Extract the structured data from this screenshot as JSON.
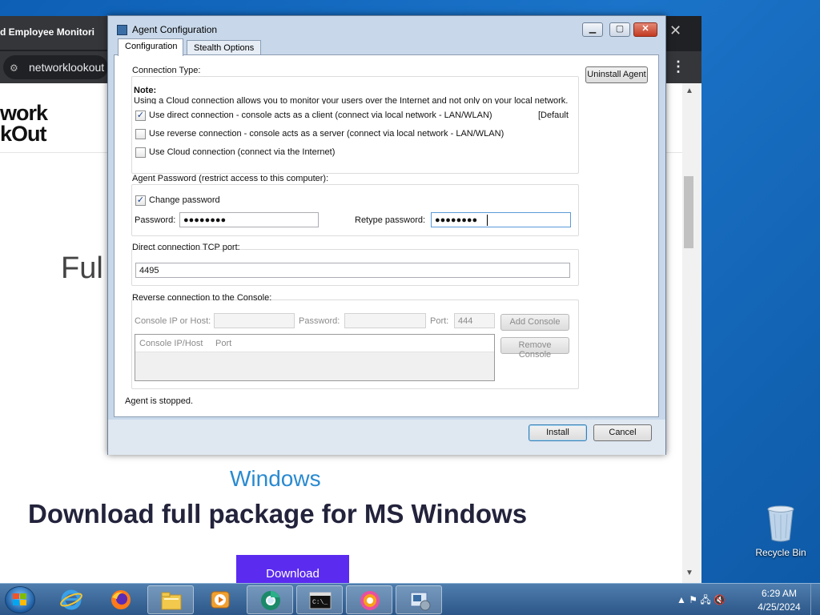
{
  "browser": {
    "tab_title": "d Employee Monitori",
    "address": "networklookout",
    "logo_line1": "work",
    "logo_line2": "kOut",
    "page_heading_partial": "Ful",
    "page_subheading": "Windows",
    "download_heading": "Download full package for MS Windows",
    "download_button": "Download"
  },
  "dialog": {
    "title": "Agent Configuration",
    "tabs": [
      {
        "label": "Configuration",
        "active": true
      },
      {
        "label": "Stealth Options",
        "active": false
      }
    ],
    "uninstall_button": "Uninstall Agent",
    "connection_type": {
      "title": "Connection Type:",
      "note_label": "Note:",
      "note_text": "Using a Cloud connection allows you to monitor your users over the Internet and not only on your local network.",
      "options": [
        {
          "label": "Use direct connection - console acts as a client (connect via local network - LAN/WLAN)",
          "checked": true
        },
        {
          "label": "Use reverse connection - console acts as a server (connect via local network - LAN/WLAN)",
          "checked": false
        },
        {
          "label": "Use Cloud connection (connect via the Internet)",
          "checked": false
        }
      ],
      "default_tag": "[Default"
    },
    "agent_password": {
      "title": "Agent Password (restrict access to this computer):",
      "change_label": "Change password",
      "change_checked": true,
      "password_label": "Password:",
      "password_value": "●●●●●●●●",
      "retype_label": "Retype password:",
      "retype_value": "●●●●●●●●"
    },
    "tcp_port": {
      "title": "Direct connection TCP port:",
      "value": "4495"
    },
    "reverse": {
      "title": "Reverse connection to the Console:",
      "ip_label": "Console IP or Host:",
      "password_label": "Password:",
      "port_label": "Port:",
      "port_value": "444",
      "add_button": "Add Console",
      "remove_button": "Remove Console",
      "columns": [
        "Console IP/Host",
        "Port"
      ]
    },
    "status": "Agent is stopped.",
    "install_button": "Install",
    "cancel_button": "Cancel"
  },
  "desktop": {
    "recycle_bin": "Recycle Bin"
  },
  "taskbar": {
    "items": [
      {
        "icon": "internet-explorer-icon",
        "active": false
      },
      {
        "icon": "firefox-icon",
        "active": false
      },
      {
        "icon": "file-explorer-icon",
        "active": true
      },
      {
        "icon": "media-player-icon",
        "active": false
      },
      {
        "icon": "chrome-app-icon",
        "active": true
      },
      {
        "icon": "command-prompt-icon",
        "active": true
      },
      {
        "icon": "media-center-icon",
        "active": true
      },
      {
        "icon": "agent-setup-icon",
        "active": true
      }
    ],
    "time": "6:29 AM",
    "date": "4/25/2024"
  }
}
